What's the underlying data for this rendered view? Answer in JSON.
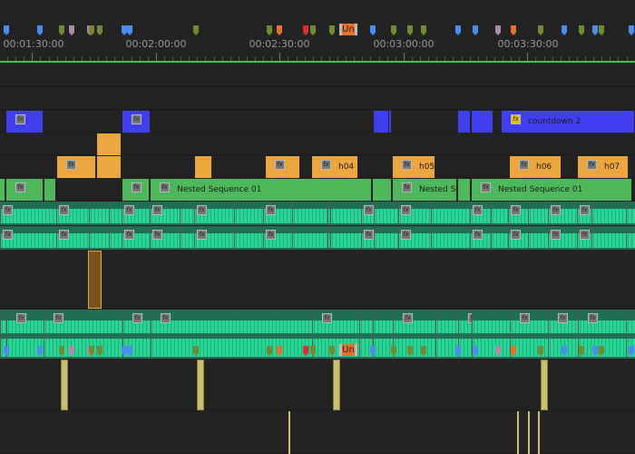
{
  "ruler": {
    "timecodes": [
      "00:01:30:00",
      "00:02:00:00",
      "00:02:30:00",
      "00:03:00:00",
      "00:03:30:00"
    ],
    "marker_colors": {
      "blue": "#4a8cf0",
      "green": "#6f8a30",
      "purple": "#b08aaa",
      "orange": "#e8712a",
      "red": "#d83030"
    },
    "selected_marker_label": "Un"
  },
  "playhead_color": "#1ed53a",
  "clips": {
    "fx_label": "fx",
    "v4_title": "countdown 2",
    "v2_titles": [
      "h04",
      "h05",
      "h06",
      "h07"
    ],
    "v1_titles": [
      "Nested Sequence 01",
      "Nested Se",
      "Nested Sequence 01"
    ]
  },
  "track_colors": {
    "video_blue": "#3f3ff0",
    "video_orange": "#eba63f",
    "video_green": "#4fb85a",
    "audio": "#1f6e55",
    "waveform": "#2ad695"
  }
}
